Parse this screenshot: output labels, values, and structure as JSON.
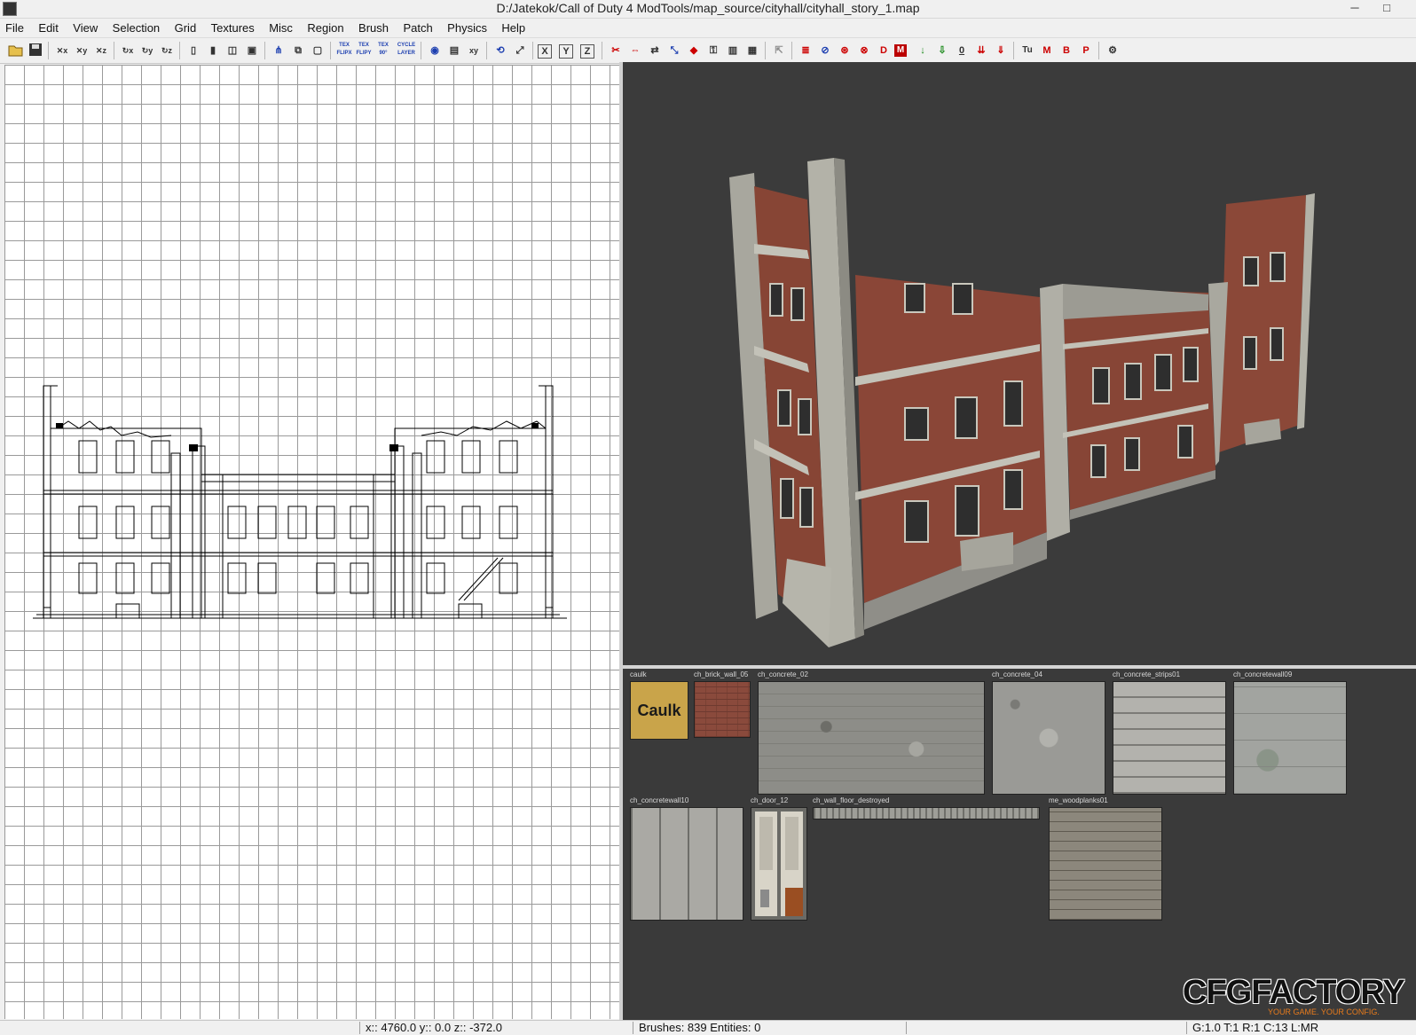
{
  "window": {
    "title": "D:/Jatekok/Call of Duty 4 ModTools/map_source/cityhall/cityhall_story_1.map",
    "minimize": "─",
    "maximize": "□"
  },
  "menu": [
    "File",
    "Edit",
    "View",
    "Selection",
    "Grid",
    "Textures",
    "Misc",
    "Region",
    "Brush",
    "Patch",
    "Physics",
    "Help"
  ],
  "toolbar": {
    "icons": [
      "open-icon",
      "save-icon",
      "flip-x-icon",
      "flip-y-icon",
      "flip-z-icon",
      "rotate-x-icon",
      "rotate-y-icon",
      "rotate-z-icon",
      "select-touching-icon",
      "select-inside-icon",
      "select-partial-icon",
      "select-complete-icon",
      "csg-subtract-icon",
      "csg-merge-icon",
      "hollow-icon",
      "tex-flip-x-icon",
      "tex-flip-y-icon",
      "tex-rotate-90-icon",
      "cycle-layer-icon",
      "camera-icon",
      "texture-window-icon",
      "xy-view-icon",
      "rotate-icon",
      "scale-icon",
      "axis-x-icon",
      "axis-y-icon",
      "axis-z-icon",
      "clipper-icon",
      "drag-edges-icon",
      "drag-vertices-icon",
      "path-icon",
      "lock-icon",
      "filter-icon",
      "brush-icon",
      "cube-icon",
      "entity-icon",
      "patch-icon",
      "no-icon",
      "dont-icon",
      "d-icon",
      "m-icon",
      "down-arrow-icon",
      "down-arrow-2-icon",
      "zero-icon",
      "double-down-icon",
      "triple-down-icon",
      "tu-icon",
      "m-red-icon",
      "b-icon",
      "p-icon",
      "plugin-icon"
    ],
    "labels": {
      "texflip1": "TEX FLIPX",
      "texflip2": "TEX FLIPY",
      "texrot": "TEX 90°",
      "cycle": "CYCLE LAYER",
      "x": "X",
      "y": "Y",
      "z": "Z",
      "d": "D",
      "zero": "0",
      "tu": "Tu",
      "m": "M",
      "b": "B",
      "p": "P"
    }
  },
  "textures": [
    {
      "name": "caulk",
      "swatch_text": "Caulk"
    },
    {
      "name": "ch_brick_wall_05"
    },
    {
      "name": "ch_concrete_02"
    },
    {
      "name": "ch_concrete_04"
    },
    {
      "name": "ch_concrete_strips01"
    },
    {
      "name": "ch_concretewall09"
    },
    {
      "name": "ch_concretewall10"
    },
    {
      "name": "ch_door_12"
    },
    {
      "name": "ch_wall_floor_destroyed"
    },
    {
      "name": "me_woodplanks01"
    }
  ],
  "status": {
    "coords": "x:: 4760.0  y:: 0.0  z:: -372.0",
    "counts": "Brushes: 839 Entities: 0",
    "grid": "G:1.0 T:1 R:1 C:13 L:MR"
  },
  "watermark": {
    "logo": "CFGFACTORY",
    "tagline": "YOUR GAME. YOUR CONFIG."
  },
  "colors": {
    "viewport_bg": "#3b3b3b",
    "caulk": "#c9a44a",
    "brick": "#8a4a3c"
  }
}
